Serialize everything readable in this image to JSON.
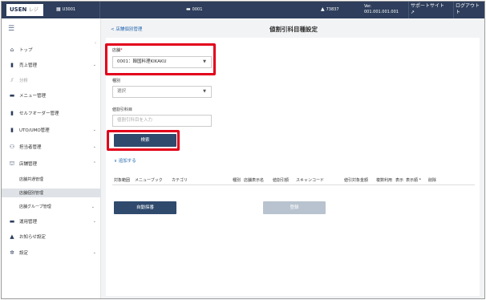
{
  "header": {
    "logo_main": "USEN",
    "logo_sub": "レジ",
    "store_code": "U3001",
    "terminal": "0001",
    "user": "73837",
    "version_label": "Ver.",
    "version_value": "001.001.001.001",
    "support_label": "サポートサイト",
    "logout_label": "ログアウト"
  },
  "sidebar": {
    "items": [
      {
        "label": "トップ",
        "icon": "home-icon",
        "glyph": "⌂",
        "chevron": ""
      },
      {
        "label": "売上管理",
        "icon": "sales-icon",
        "glyph": "▮",
        "chevron": "⌄"
      },
      {
        "label": "分析",
        "icon": "chart-icon",
        "glyph": "⩘",
        "chevron": ""
      },
      {
        "label": "メニュー管理",
        "icon": "menu-icon",
        "glyph": "▬",
        "chevron": ""
      },
      {
        "label": "セルフオーダー管理",
        "icon": "self-order-icon",
        "glyph": "▮",
        "chevron": ""
      },
      {
        "label": "UTO/UMO管理",
        "icon": "uto-icon",
        "glyph": "▮",
        "chevron": "⌄"
      },
      {
        "label": "担当者管理",
        "icon": "staff-icon",
        "glyph": "⚇",
        "chevron": "⌄"
      },
      {
        "label": "店舗管理",
        "icon": "store-icon",
        "glyph": "⛫",
        "chevron": "⌃"
      }
    ],
    "sub_items": [
      {
        "label": "店舗共通管理",
        "chevron": ""
      },
      {
        "label": "店舗個別管理",
        "chevron": ""
      },
      {
        "label": "店舗グループ管理",
        "chevron": "⌄"
      }
    ],
    "items_after": [
      {
        "label": "運用管理",
        "icon": "operation-icon",
        "glyph": "▬",
        "chevron": "⌄"
      },
      {
        "label": "お知らせ設定",
        "icon": "notice-icon",
        "glyph": "🔔",
        "chevron": ""
      },
      {
        "label": "設定",
        "icon": "settings-icon",
        "glyph": "⚙",
        "chevron": "⌄"
      }
    ]
  },
  "main": {
    "back_link": "< 店舗個別管理",
    "page_title": "値割引科目種設定",
    "store_label": "店舗",
    "store_required": "*",
    "store_value": "0001：韓国料理KIKAKU",
    "type_label": "種別",
    "type_value": "選択",
    "discount_label": "値割引科目",
    "discount_placeholder": "値割引科目を入力",
    "search_button": "検索",
    "add_link": "∨ 追加する",
    "table_headers": [
      "対象範囲",
      "メニューブック",
      "カテゴリ",
      "種別",
      "店舗表示名",
      "値割引額",
      "スキャンコード",
      "値引対象金額",
      "複数利用",
      "表示",
      "表示順 *",
      "削除"
    ],
    "auto_number_button": "自動採番",
    "register_button": "登録"
  },
  "colors": {
    "header_bg": "#2e3e5c",
    "primary": "#2f4a6d",
    "highlight": "#e3001b"
  }
}
